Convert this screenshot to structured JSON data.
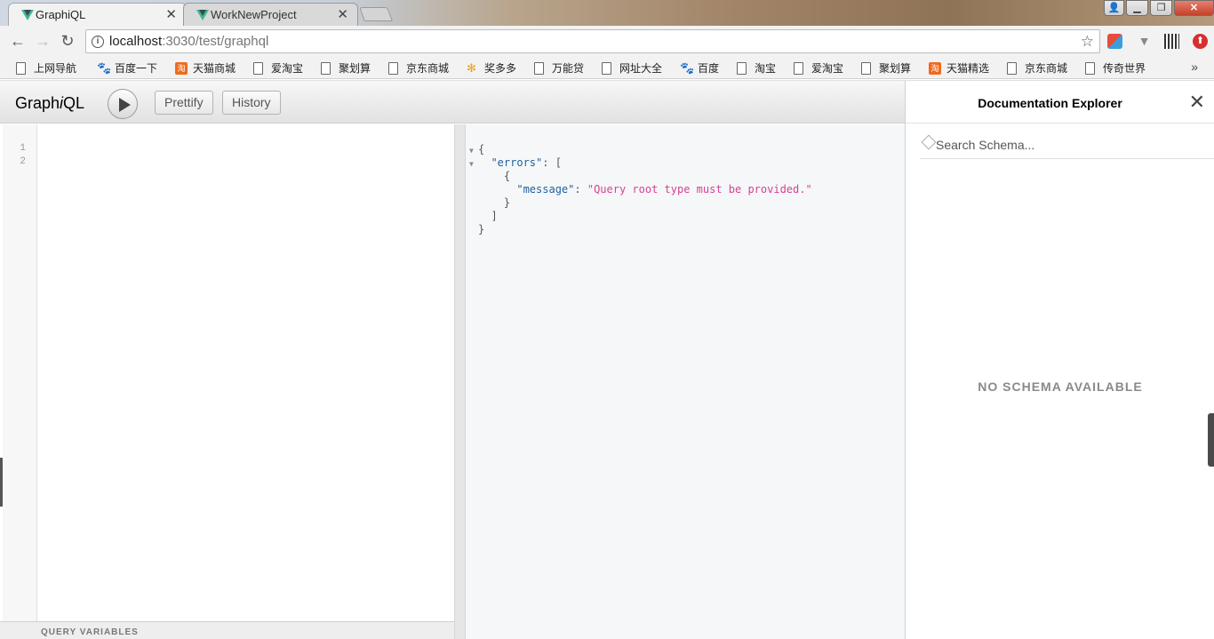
{
  "browser": {
    "tabs": [
      {
        "title": "GraphiQL",
        "active": true
      },
      {
        "title": "WorkNewProject",
        "active": false
      }
    ],
    "url_host": "localhost",
    "url_rest": ":3030/test/graphql"
  },
  "bookmarks": [
    {
      "label": "上网导航",
      "icon": "page-icon"
    },
    {
      "label": "百度一下",
      "icon": "baidu-paw-icon"
    },
    {
      "label": "天猫商城",
      "icon": "taobao-icon"
    },
    {
      "label": "爱淘宝",
      "icon": "page-icon"
    },
    {
      "label": "聚划算",
      "icon": "page-icon"
    },
    {
      "label": "京东商城",
      "icon": "page-icon"
    },
    {
      "label": "奖多多",
      "icon": "pinwheel-icon"
    },
    {
      "label": "万能贷",
      "icon": "page-icon"
    },
    {
      "label": "网址大全",
      "icon": "page-icon"
    },
    {
      "label": "百度",
      "icon": "baidu-paw-icon"
    },
    {
      "label": "淘宝",
      "icon": "page-icon"
    },
    {
      "label": "爱淘宝",
      "icon": "page-icon"
    },
    {
      "label": "聚划算",
      "icon": "page-icon"
    },
    {
      "label": "天猫精选",
      "icon": "taobao-icon"
    },
    {
      "label": "京东商城",
      "icon": "page-icon"
    },
    {
      "label": "传奇世界",
      "icon": "page-icon"
    }
  ],
  "graphiql": {
    "logo_prefix": "Graph",
    "logo_i": "i",
    "logo_suffix": "QL",
    "prettify_label": "Prettify",
    "history_label": "History",
    "line_numbers": [
      "1",
      "2"
    ],
    "query_variables_label": "QUERY VARIABLES",
    "result": {
      "open_brace": "{",
      "errors_key": "\"errors\"",
      "open_bracket": "[",
      "inner_open": "{",
      "message_key": "\"message\"",
      "message_value": "\"Query root type must be provided.\"",
      "inner_close": "}",
      "close_bracket": "]",
      "close_brace": "}"
    }
  },
  "docs": {
    "title": "Documentation Explorer",
    "search_placeholder": "Search Schema...",
    "empty_message": "NO SCHEMA AVAILABLE"
  }
}
